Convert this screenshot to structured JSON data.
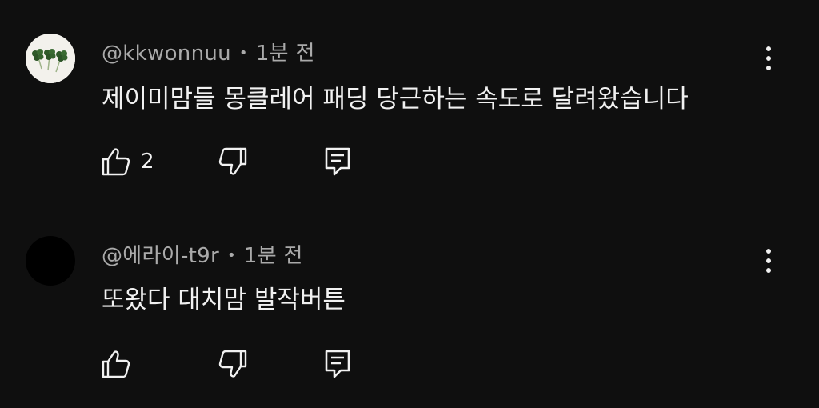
{
  "comments": [
    {
      "author": "@kkwonnuu",
      "separator": "•",
      "time": "1분 전",
      "text": "제이미맘들 몽클레어 패딩 당근하는 속도로 달려왔습니다",
      "like_count": "2",
      "avatar": "clover-avatar"
    },
    {
      "author": "@에라이-t9r",
      "separator": "•",
      "time": "1분 전",
      "text": "또왔다 대치맘 발작버튼",
      "like_count": "",
      "avatar": "dark-avatar"
    }
  ],
  "colors": {
    "background": "#0f0f0f",
    "primary_text": "#f1f1f1",
    "secondary_text": "#aaaaaa"
  }
}
